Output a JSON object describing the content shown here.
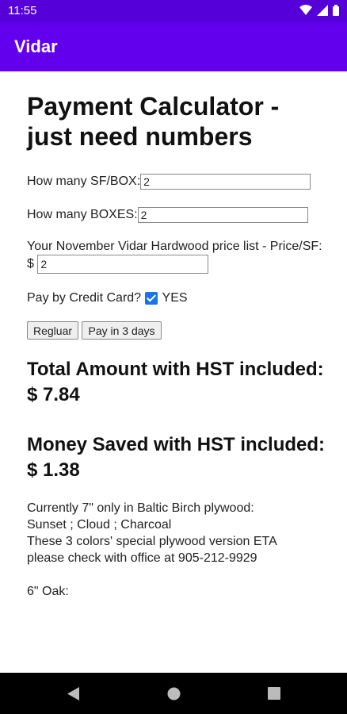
{
  "status": {
    "time": "11:55"
  },
  "app": {
    "title": "Vidar"
  },
  "page": {
    "title": "Payment Calculator - just need numbers",
    "sf_label": "How many SF/BOX:",
    "sf_value": "2",
    "boxes_label": "How many BOXES:",
    "boxes_value": "2",
    "price_label": "Your November Vidar Hardwood price list - Price/SF:",
    "currency_symbol": "$",
    "price_value": "2",
    "credit_label": "Pay by Credit Card?",
    "credit_yes": "YES",
    "credit_checked": true,
    "btn_regular": "Regluar",
    "btn_3days": "Pay in 3 days",
    "total_title": "Total Amount with HST included:",
    "total_value": "$ 7.84",
    "saved_title": "Money Saved with HST included:",
    "saved_value": "$ 1.38",
    "note_line1": "Currently 7\" only in Baltic Birch plywood:",
    "note_line2": "Sunset ; Cloud ; Charcoal",
    "note_line3": "These 3 colors' special plywood version ETA",
    "note_line4": "please check with office at 905-212-9929",
    "next_section": "6\" Oak:"
  }
}
